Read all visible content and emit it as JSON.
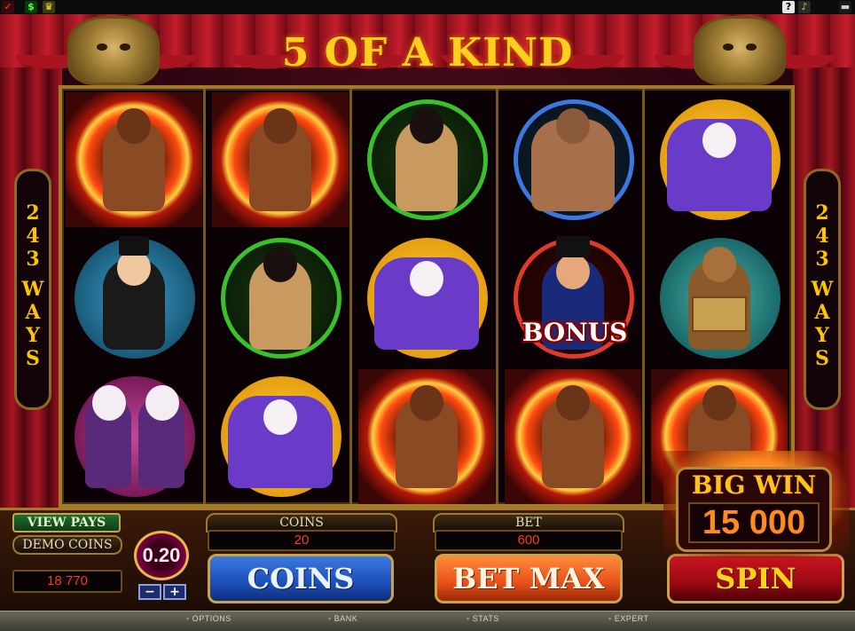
{
  "title": "5 OF A KIND",
  "side_badge": {
    "line1": "243",
    "line2": "WAYS"
  },
  "reels": [
    [
      {
        "symbol": "fire-eater",
        "winning": true
      },
      {
        "symbol": "magician-lady",
        "winning": false
      },
      {
        "symbol": "twins",
        "winning": false
      }
    ],
    [
      {
        "symbol": "fire-eater",
        "winning": true
      },
      {
        "symbol": "snake-charmer",
        "winning": false
      },
      {
        "symbol": "jester",
        "winning": false
      }
    ],
    [
      {
        "symbol": "snake-charmer",
        "winning": false
      },
      {
        "symbol": "jester",
        "winning": false
      },
      {
        "symbol": "fire-eater",
        "winning": true
      }
    ],
    [
      {
        "symbol": "strongman",
        "winning": false
      },
      {
        "symbol": "ringmaster-bonus",
        "winning": false,
        "label": "BONUS"
      },
      {
        "symbol": "fire-eater",
        "winning": true
      }
    ],
    [
      {
        "symbol": "jester",
        "winning": false
      },
      {
        "symbol": "monkey",
        "winning": false
      },
      {
        "symbol": "fire-eater",
        "winning": true
      }
    ]
  ],
  "view_pays": "VIEW PAYS",
  "demo_coins": "DEMO COINS",
  "demo_coins_value": "18 770",
  "coin_value": "0.20",
  "coins_label": "COINS",
  "coins_value": "20",
  "bet_label": "BET",
  "bet_value": "600",
  "coins_button": "COINS",
  "bet_max_button": "BET MAX",
  "spin_button": "SPIN",
  "big_win": {
    "title": "BIG WIN",
    "amount": "15 000"
  },
  "menu": [
    "OPTIONS",
    "BANK",
    "STATS",
    "EXPERT"
  ],
  "sys_icons": [
    "checkmark-icon",
    "dollar-icon",
    "crown-icon",
    "help-icon",
    "sound-icon",
    "minimize-icon"
  ],
  "colors": {
    "accent_gold": "#ffcf1f",
    "readout_red": "#ff3a1a",
    "coins_blue": "#1d4fb8",
    "betmax_orange": "#e8501a",
    "spin_red": "#9a0a14"
  }
}
